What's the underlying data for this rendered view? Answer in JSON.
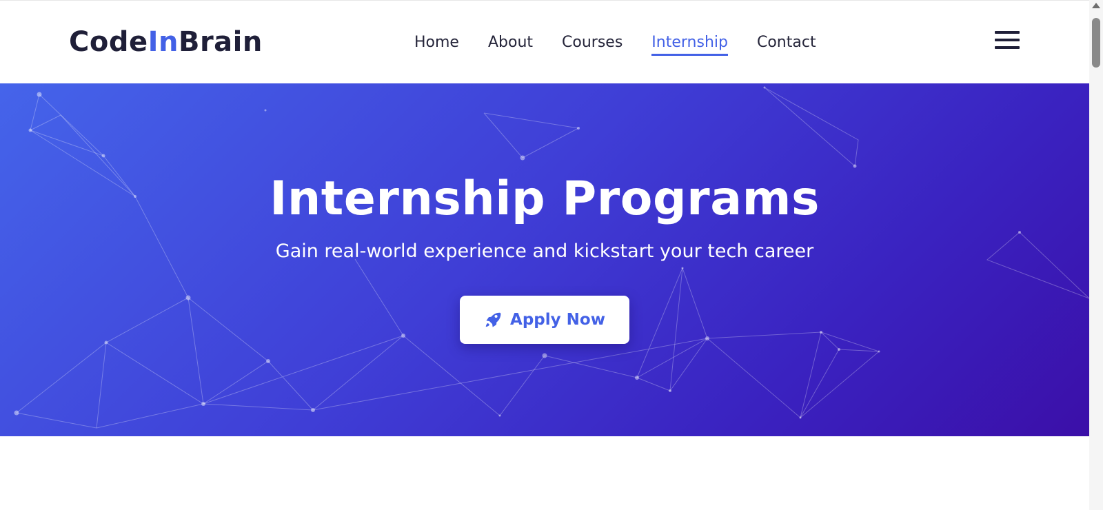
{
  "brand": {
    "logo_prefix": "Code",
    "logo_accent": "In",
    "logo_suffix": "Brain"
  },
  "nav": {
    "items": [
      {
        "label": "Home"
      },
      {
        "label": "About"
      },
      {
        "label": "Courses"
      },
      {
        "label": "Internship",
        "active": true
      },
      {
        "label": "Contact"
      }
    ],
    "menu_icon": "hamburger-icon"
  },
  "hero": {
    "title": "Internship Programs",
    "subtitle": "Gain real-world experience and kickstart your tech career",
    "cta": {
      "label": "Apply Now",
      "icon": "rocket-icon"
    }
  },
  "colors": {
    "accent": "#4361e6",
    "text_dark": "#1f1f38",
    "hero_gradient_start": "#4564ea",
    "hero_gradient_end": "#3b0fa8"
  }
}
